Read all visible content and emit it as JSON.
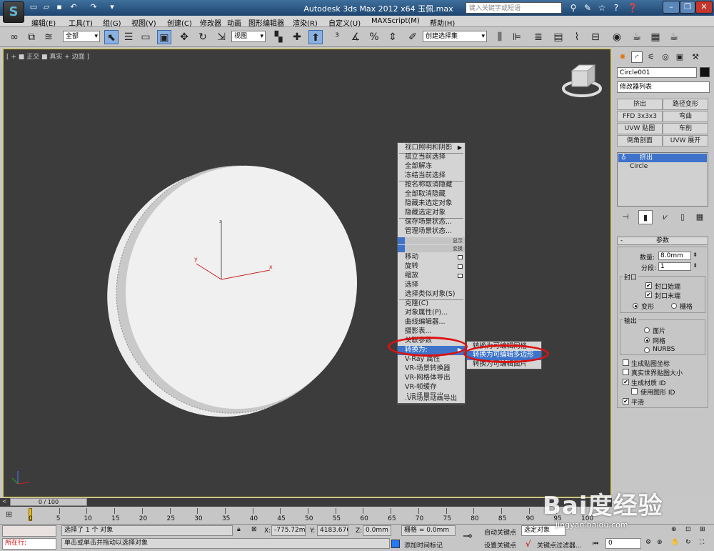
{
  "titlebar": {
    "title": "Autodesk 3ds Max 2012 x64    玉佩.max",
    "search_placeholder": "键入关键字或短语",
    "logo_text": "S"
  },
  "menubar": {
    "items": [
      "编辑(E)",
      "工具(T)",
      "组(G)",
      "视图(V)",
      "创建(C)",
      "修改器",
      "动画",
      "图形编辑器",
      "渲染(R)",
      "自定义(U)",
      "MAXScript(M)",
      "帮助(H)"
    ]
  },
  "toolbar": {
    "filter_value": "全部",
    "coord_value": "视图",
    "named_selection_placeholder": "创建选择集"
  },
  "viewport": {
    "label": "[ + ■ 正交 ■ 真实 + 边面 ]",
    "axis_x": "x",
    "axis_y": "y",
    "axis_z": "z"
  },
  "context_menu": {
    "items": [
      {
        "label": "视口照明和阴影",
        "arrow": true
      },
      {
        "label": "孤立当前选择"
      },
      {
        "label": "全部解冻"
      },
      {
        "label": "冻结当前选择"
      },
      {
        "label": "按名称取消隐藏"
      },
      {
        "label": "全部取消隐藏"
      },
      {
        "label": "隐藏未选定对象"
      },
      {
        "label": "隐藏选定对象"
      },
      {
        "label": "保存场景状态..."
      },
      {
        "label": "管理场景状态..."
      }
    ],
    "quad_labels": [
      "显示",
      "变换"
    ],
    "transform_items": [
      {
        "label": "移动",
        "box": true
      },
      {
        "label": "旋转",
        "box": true
      },
      {
        "label": "缩放",
        "box": true
      },
      {
        "label": "选择"
      },
      {
        "label": "选择类似对象(S)"
      },
      {
        "label": "克隆(C)"
      },
      {
        "label": "对象属性(P)..."
      },
      {
        "label": "曲线编辑器..."
      },
      {
        "label": "摄影表..."
      },
      {
        "label": "关联参数"
      },
      {
        "label": "转换为:",
        "arrow": true,
        "highlight": true
      },
      {
        "label": "V-Ray 属性"
      },
      {
        "label": "VR-场景转换器"
      },
      {
        "label": "VR-网格体导出"
      },
      {
        "label": "VR-帧缓存"
      },
      {
        "label": ".VR场景导出"
      },
      {
        "label": ".VR场景动画导出"
      }
    ],
    "submenu": [
      {
        "label": "转换为可编辑网格"
      },
      {
        "label": "转换为可编辑多边形",
        "highlight": true
      },
      {
        "label": "转换为可编辑面片"
      }
    ]
  },
  "command_panel": {
    "object_name": "Circle001",
    "modifier_list": "修改器列表",
    "modifier_buttons": [
      "挤出",
      "路径变形",
      "FFD 3x3x3",
      "弯曲",
      "UVW 贴图",
      "车削",
      "倒角剖面",
      "UVW 展开"
    ],
    "stack": [
      "挤出",
      "Circle"
    ],
    "params_title": "参数",
    "amount_label": "数量:",
    "amount_value": "8.0mm",
    "segments_label": "分段:",
    "segments_value": "1",
    "capping_title": "封口",
    "cap_start": "封口始端",
    "cap_end": "封口末端",
    "morph": "变形",
    "grid": "栅格",
    "output_title": "输出",
    "patch": "面片",
    "mesh": "网格",
    "nurbs": "NURBS",
    "gen_mapping": "生成贴图坐标",
    "real_world": "真实世界贴图大小",
    "gen_mat_id": "生成材质 ID",
    "use_shape_id": "使用图形 ID",
    "smooth": "平滑"
  },
  "timeline": {
    "frame": "0 / 100",
    "ticks": [
      "0",
      "5",
      "10",
      "15",
      "20",
      "25",
      "30",
      "35",
      "40",
      "45",
      "50",
      "55",
      "60",
      "65",
      "70",
      "75",
      "80",
      "85",
      "90",
      "95",
      "100"
    ]
  },
  "status": {
    "mode": "所在行:",
    "selection": "选择了 1 个 对象",
    "prompt": "单击或单击并拖动以选择对象",
    "x_label": "X:",
    "x_value": "-775.72mm",
    "y_label": "Y:",
    "y_value": "4183.676m",
    "z_label": "Z:",
    "z_value": "0.0mm",
    "grid": "栅格 = 0.0mm",
    "add_time_tag": "添加时间标记",
    "auto_key": "自动关键点",
    "set_key": "设置关键点",
    "selected": "选定对象",
    "key_filters": "关键点过滤器...",
    "frame_value": "0"
  },
  "watermark": {
    "text": "Bai度经验",
    "url": "jingyan.baidu.com"
  },
  "colors": {
    "viewport_bg": "#3c3c3c",
    "highlight": "#3e73c9",
    "ring": "#dd1111",
    "active_border": "#d8c21a"
  }
}
